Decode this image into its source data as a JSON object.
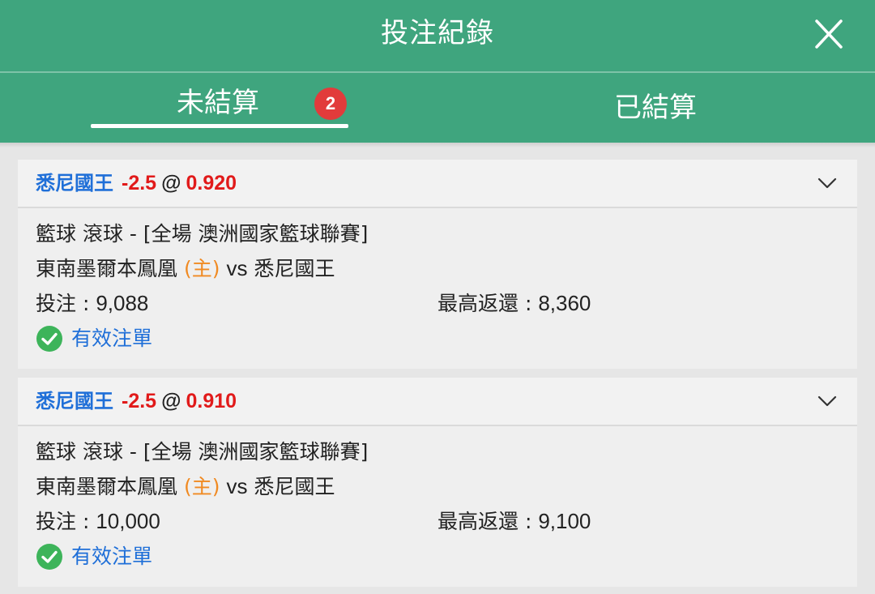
{
  "header": {
    "title": "投注紀錄"
  },
  "tabs": {
    "open": {
      "label": "未結算",
      "badge": "2"
    },
    "settled": {
      "label": "已結算"
    }
  },
  "bets": [
    {
      "team": "悉尼國王",
      "handicap": "-2.5",
      "at": "@",
      "odds": "0.920",
      "market": "籃球 滾球 - [全場 澳洲國家籃球聯賽]",
      "home_team": "東南墨爾本鳳凰",
      "home_tag": "(主)",
      "vs": "vs",
      "away_team": "悉尼國王",
      "stake_label": "投注 : ",
      "stake": "9,088",
      "max_return_label": "最高返還 : ",
      "max_return": "8,360",
      "status": "有效注單"
    },
    {
      "team": "悉尼國王",
      "handicap": "-2.5",
      "at": "@",
      "odds": "0.910",
      "market": "籃球 滾球 - [全場 澳洲國家籃球聯賽]",
      "home_team": "東南墨爾本鳳凰",
      "home_tag": "(主)",
      "vs": "vs",
      "away_team": "悉尼國王",
      "stake_label": "投注 : ",
      "stake": "10,000",
      "max_return_label": "最高返還 : ",
      "max_return": "9,100",
      "status": "有效注單"
    }
  ],
  "icons": {
    "close": "close-icon",
    "chevron": "chevron-down-icon",
    "status": "check-circle-icon"
  },
  "colors": {
    "header_green": "#3fa57e",
    "badge_red": "#e23b3b",
    "team_blue": "#1f6fd8",
    "odds_red": "#e11a1a",
    "home_orange": "#f08a22",
    "valid_green": "#3db45a"
  }
}
